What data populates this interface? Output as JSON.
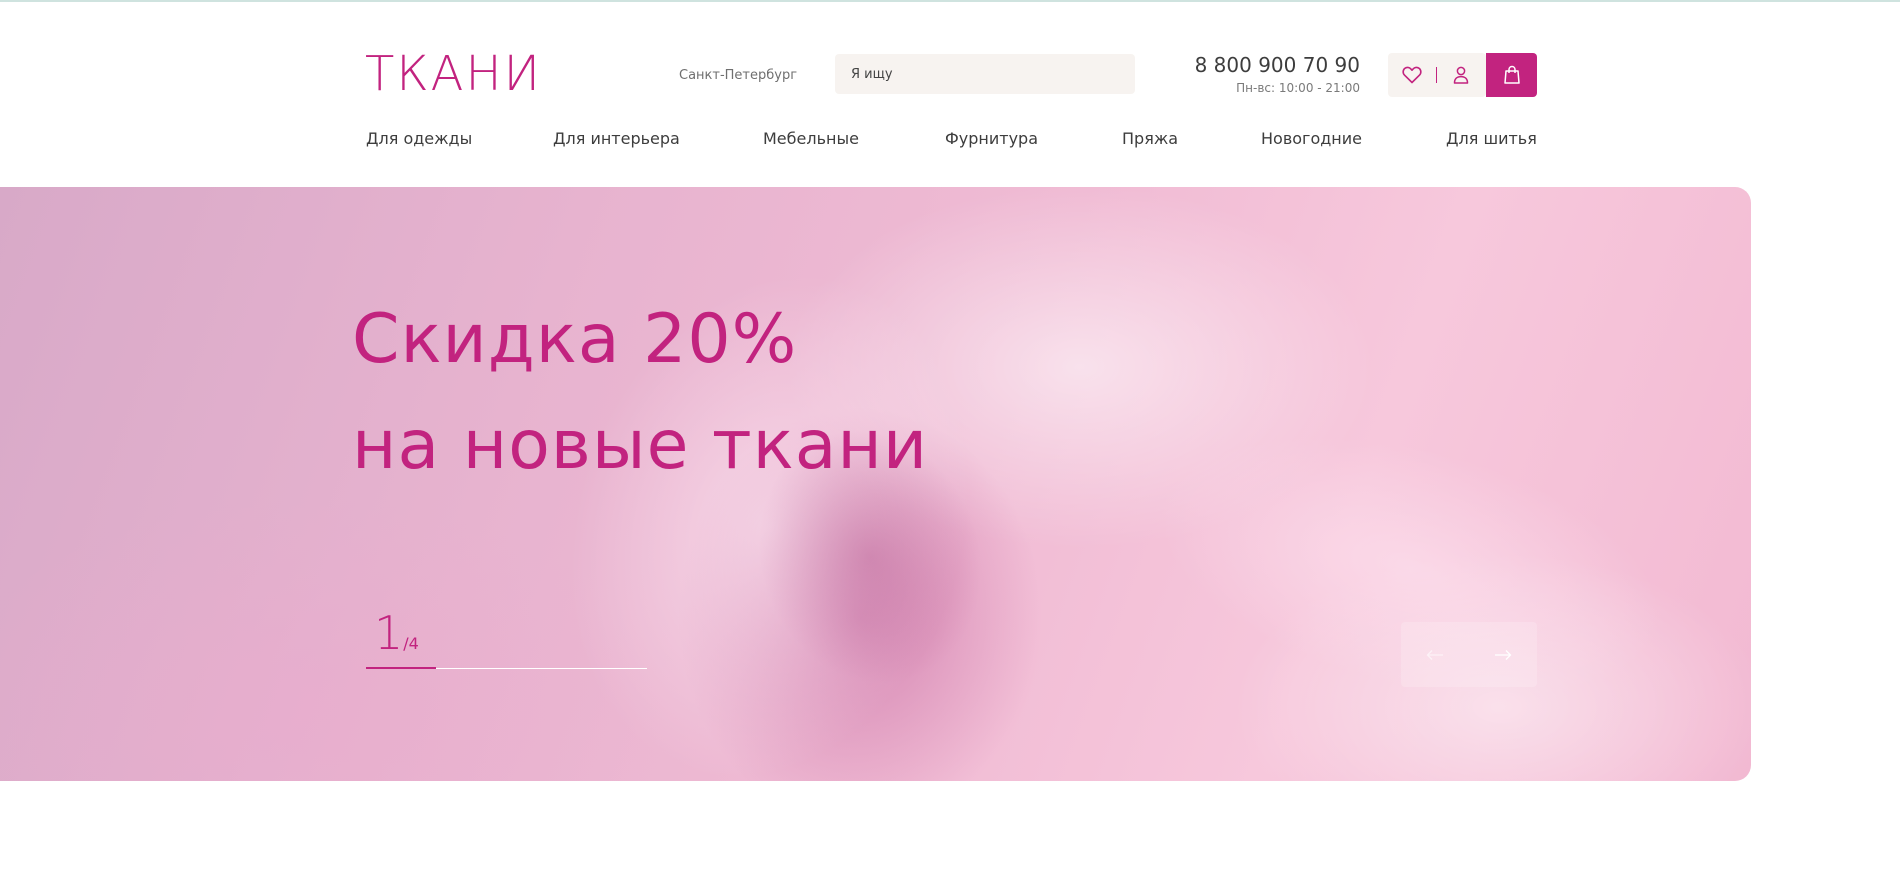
{
  "header": {
    "logo": "ТКАНИ",
    "city": "Санкт-Петербург",
    "search_placeholder": "Я ищу",
    "phone": "8 800 900 70 90",
    "hours": "Пн-вс: 10:00 - 21:00",
    "icons": [
      "heart-icon",
      "user-icon",
      "shopping-bag-icon"
    ]
  },
  "nav": {
    "items": [
      {
        "label": "Для одежды"
      },
      {
        "label": "Для интерьера"
      },
      {
        "label": "Мебельные"
      },
      {
        "label": "Фурнитура"
      },
      {
        "label": "Пряжа"
      },
      {
        "label": "Новогодние"
      },
      {
        "label": "Для шитья"
      }
    ]
  },
  "hero": {
    "title_line1": "Скидка 20%",
    "title_line2": "на новые ткани",
    "slide_current": "1",
    "slide_total": "/4",
    "progress_fraction": 0.25,
    "arrows": [
      "arrow-left-icon",
      "arrow-right-icon"
    ]
  },
  "colors": {
    "accent": "#c2237f",
    "panel_bg": "#f7f3f0",
    "text": "#3d3d3d"
  }
}
